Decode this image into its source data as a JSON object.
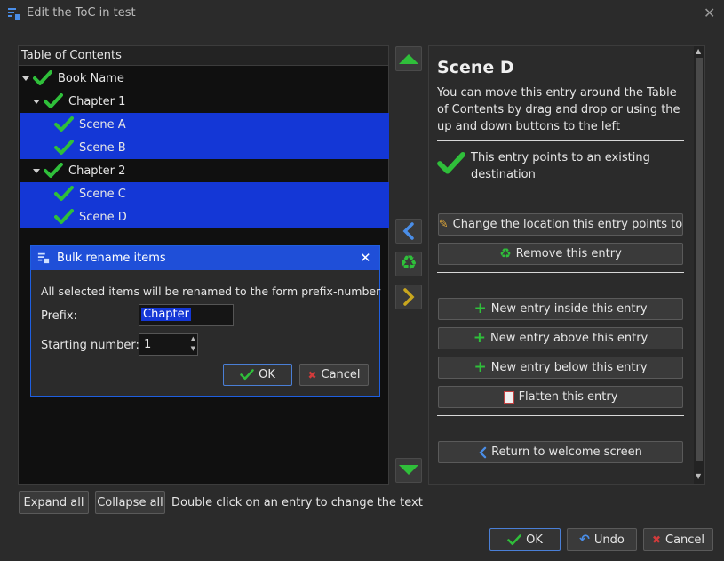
{
  "window": {
    "title": "Edit the ToC in test"
  },
  "toc": {
    "header": "Table of Contents",
    "items": [
      {
        "label": "Book Name"
      },
      {
        "label": "Chapter 1"
      },
      {
        "label": "Scene A"
      },
      {
        "label": "Scene B"
      },
      {
        "label": "Chapter 2"
      },
      {
        "label": "Scene C"
      },
      {
        "label": "Scene D"
      }
    ]
  },
  "dialog": {
    "title": "Bulk rename items",
    "description": "All selected items will be renamed to the form prefix-number",
    "prefix_label": "Prefix:",
    "prefix_value": "Chapter",
    "start_label": "Starting number:",
    "start_value": "1",
    "ok_label": "OK",
    "cancel_label": "Cancel"
  },
  "details": {
    "title": "Scene D",
    "description": "You can move this entry around the Table of Contents by drag and drop or using the up and down buttons to the left",
    "status": "This entry points to an existing destination",
    "buttons": {
      "change_location": "Change the location this entry points to",
      "remove": "Remove this entry",
      "new_inside": "New entry inside this entry",
      "new_above": "New entry above this entry",
      "new_below": "New entry below this entry",
      "flatten": "Flatten this entry",
      "return_welcome": "Return to welcome screen"
    }
  },
  "bottom": {
    "expand_all": "Expand all",
    "collapse_all": "Collapse all",
    "hint": "Double click on an entry to change the text"
  },
  "footer": {
    "ok": "OK",
    "undo": "Undo",
    "cancel": "Cancel"
  },
  "colors": {
    "selection": "#1437d6",
    "check_green": "#2fbf3a",
    "accent_blue": "#4a7fd6",
    "remove_red": "#d23b3b"
  }
}
